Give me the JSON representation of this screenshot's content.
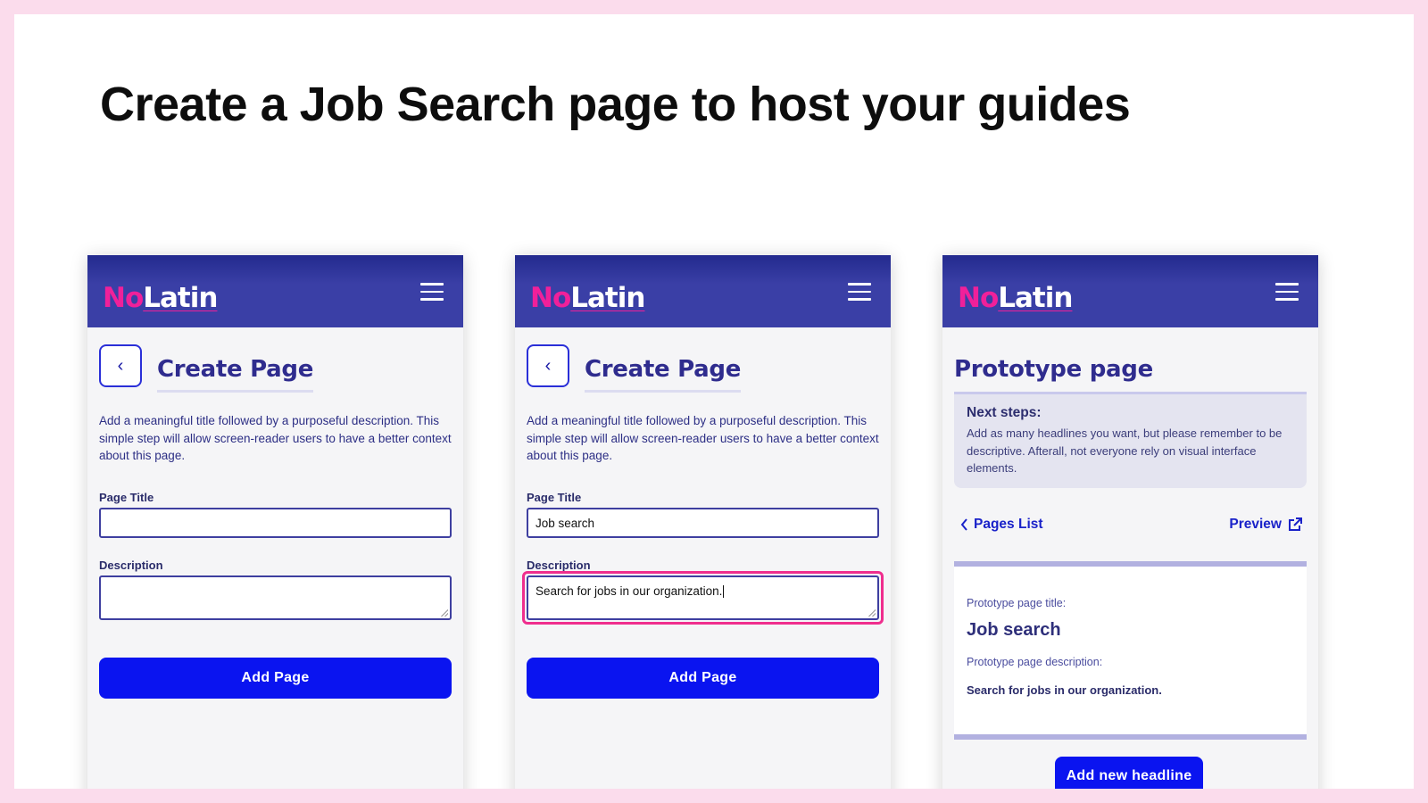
{
  "slide": {
    "title": "Create a Job Search page to host your guides"
  },
  "brand": {
    "logo_prefix": "No",
    "logo_suffix": "Latin",
    "colors": {
      "header": "#3a3fa6",
      "logo_accent": "#f0209a",
      "primary": "#0a14f0",
      "focus": "#ef2e8e"
    }
  },
  "phones": [
    {
      "heading": "Create Page",
      "intro": "Add a meaningful title followed by a purposeful description. This simple step will allow screen-reader users to have a better context about this page.",
      "page_title_label": "Page Title",
      "page_title_value": "",
      "description_label": "Description",
      "description_value": "",
      "button_label": "Add Page"
    },
    {
      "heading": "Create Page",
      "intro": "Add a meaningful title followed by a purposeful description. This simple step will allow screen-reader users to have a better context about this page.",
      "page_title_label": "Page Title",
      "page_title_value": "Job search",
      "description_label": "Description",
      "description_value": "Search for jobs in our organization.",
      "button_label": "Add Page"
    },
    {
      "heading": "Prototype page",
      "next_steps_title": "Next steps:",
      "next_steps_text": "Add as many headlines you want, but please remember to be descriptive. Afterall, not everyone rely on visual interface elements.",
      "pages_list_link": "Pages List",
      "preview_link": "Preview",
      "title_label": "Prototype page title:",
      "title_value": "Job search",
      "description_label": "Prototype page description:",
      "description_value": "Search for jobs in our organization.",
      "button_label": "Add new headline"
    }
  ],
  "icons": {
    "menu": "hamburger-icon",
    "back": "chevron-left-icon",
    "external": "external-link-icon"
  }
}
